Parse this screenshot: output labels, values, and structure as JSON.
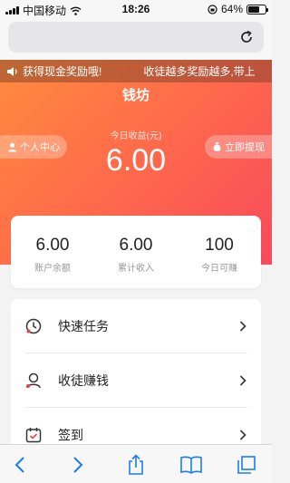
{
  "status_bar": {
    "carrier": "中国移动",
    "time": "18:26",
    "battery": "64%",
    "battery_level": 0.64
  },
  "browser": {
    "reload_icon": "reload-icon"
  },
  "notice": {
    "message_1": "获得现金奖励哦!",
    "message_2": "收徒越多奖励越多,带上"
  },
  "header": {
    "title": "钱坊",
    "profile_button": "个人中心",
    "withdraw_button": "立即提现",
    "today_label": "今日收益(元)",
    "today_value": "6.00"
  },
  "stats": [
    {
      "value": "6.00",
      "label": "账户余额"
    },
    {
      "value": "6.00",
      "label": "累计收入"
    },
    {
      "value": "100",
      "label": "今日可赚"
    }
  ],
  "menu": [
    {
      "label": "快速任务",
      "icon": "clock-icon"
    },
    {
      "label": "收徒赚钱",
      "icon": "user-icon"
    },
    {
      "label": "签到",
      "icon": "calendar-check-icon"
    }
  ],
  "colors": {
    "hero_start": "#ff8b3d",
    "hero_end": "#f84a5c",
    "accent": "#e8424c",
    "ios_blue": "#1a7cf5"
  }
}
